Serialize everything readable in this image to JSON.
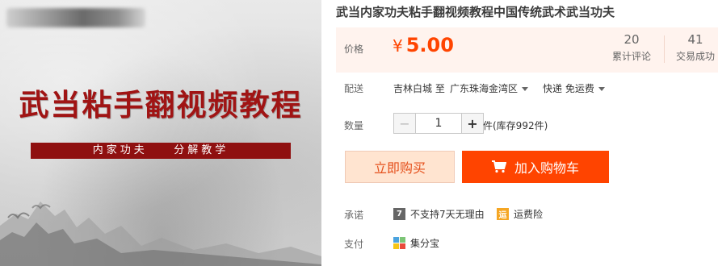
{
  "image": {
    "title": "武当粘手翻视频教程",
    "banner": "内家功夫    分解教学"
  },
  "product": {
    "title": "武当内家功夫粘手翻视频教程中国传统武术武当功夫"
  },
  "price": {
    "label": "价格",
    "currency": "¥",
    "value": "5.00",
    "reviews": {
      "count": "20",
      "label": "累计评论"
    },
    "sales": {
      "count": "41",
      "label": "交易成功"
    }
  },
  "shipping": {
    "label": "配送",
    "from": "吉林白城 至",
    "to": "广东珠海金湾区",
    "method": "快递 免运费"
  },
  "quantity": {
    "label": "数量",
    "value": "1",
    "minus": "−",
    "plus": "+",
    "stock": "件(库存992件)"
  },
  "actions": {
    "buy_now": "立即购买",
    "add_to_cart": "加入购物车"
  },
  "promise": {
    "label": "承诺",
    "items": [
      {
        "badge": "7",
        "text": "不支持7天无理由"
      },
      {
        "badge": "运",
        "text": "运费险"
      }
    ]
  },
  "payment": {
    "label": "支付",
    "method": "集分宝"
  },
  "colors": {
    "accent": "#ff4400",
    "price": "#ff4400",
    "price_bg": "#fff3ee",
    "banner": "#8f1010"
  }
}
